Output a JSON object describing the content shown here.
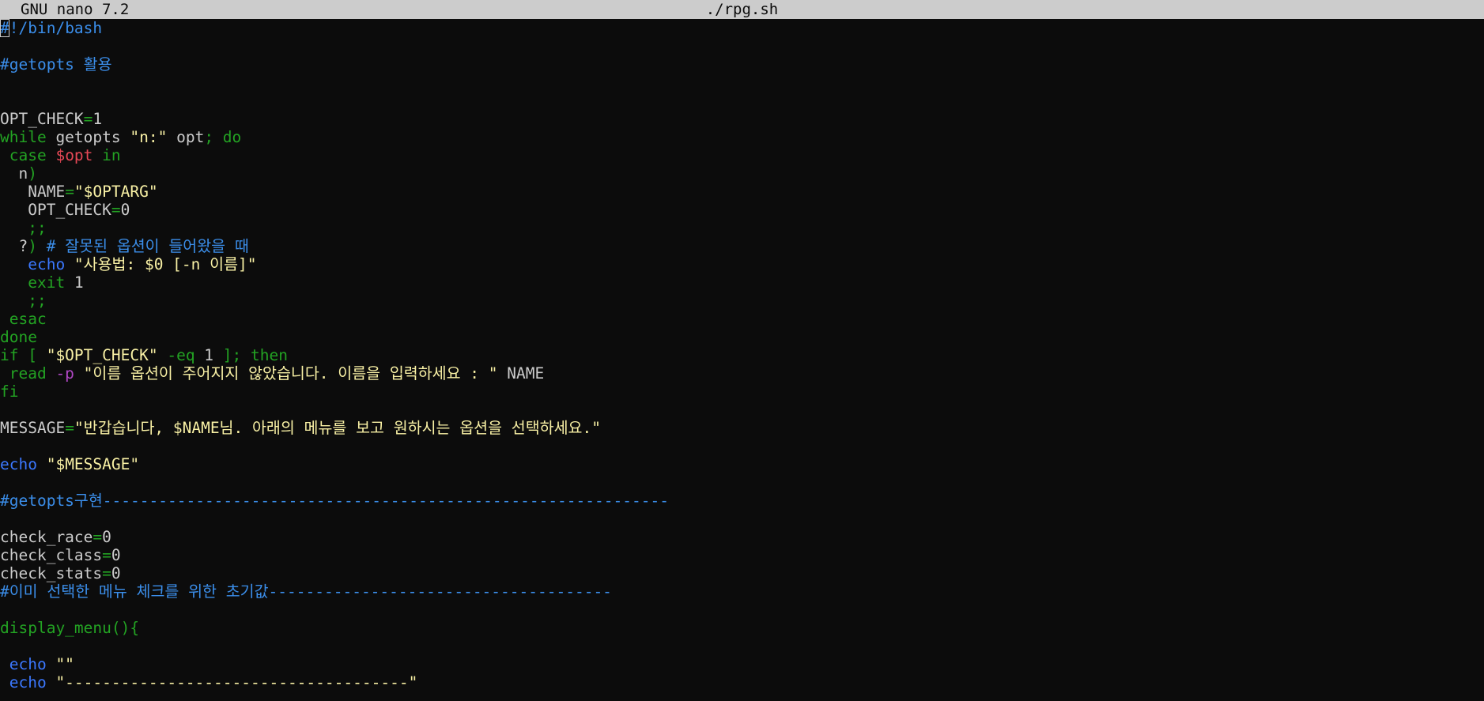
{
  "titlebar": {
    "app_name": "GNU nano 7.2",
    "file_name": "./rpg.sh"
  },
  "colors": {
    "background": "#0c0c0c",
    "default": "#cccccc",
    "comment": "#3b8eea",
    "keyword": "#23a323",
    "builtin": "#3b78ff",
    "string": "#f9f1a5",
    "variable": "#e74856",
    "option": "#b148c6",
    "titlebar": "#cccccc"
  },
  "lines": [
    [
      {
        "t": "#!/bin/bash",
        "c": "comment"
      }
    ],
    [],
    [
      {
        "t": "#getopts 활용",
        "c": "comment"
      }
    ],
    [],
    [],
    [
      {
        "t": "OPT_CHECK",
        "c": "default"
      },
      {
        "t": "=",
        "c": "keyword"
      },
      {
        "t": "1",
        "c": "default"
      }
    ],
    [
      {
        "t": "while",
        "c": "keyword"
      },
      {
        "t": " getopts ",
        "c": "default"
      },
      {
        "t": "\"n:\"",
        "c": "string"
      },
      {
        "t": " opt",
        "c": "default"
      },
      {
        "t": "; do",
        "c": "keyword"
      }
    ],
    [
      {
        "t": " case ",
        "c": "keyword"
      },
      {
        "t": "$opt",
        "c": "variable"
      },
      {
        "t": " in",
        "c": "keyword"
      }
    ],
    [
      {
        "t": "  n",
        "c": "default"
      },
      {
        "t": ")",
        "c": "keyword"
      }
    ],
    [
      {
        "t": "   NAME",
        "c": "default"
      },
      {
        "t": "=",
        "c": "keyword"
      },
      {
        "t": "\"$OPTARG\"",
        "c": "string"
      }
    ],
    [
      {
        "t": "   OPT_CHECK",
        "c": "default"
      },
      {
        "t": "=",
        "c": "keyword"
      },
      {
        "t": "0",
        "c": "default"
      }
    ],
    [
      {
        "t": "   ;;",
        "c": "keyword"
      }
    ],
    [
      {
        "t": "  ?",
        "c": "default"
      },
      {
        "t": ")",
        "c": "keyword"
      },
      {
        "t": " # 잘못된 옵션이 들어왔을 때",
        "c": "comment"
      }
    ],
    [
      {
        "t": "   echo",
        "c": "builtin"
      },
      {
        "t": " \"사용법: $0 [-n 이름]\"",
        "c": "string"
      }
    ],
    [
      {
        "t": "   exit",
        "c": "keyword"
      },
      {
        "t": " 1",
        "c": "default"
      }
    ],
    [
      {
        "t": "   ;;",
        "c": "keyword"
      }
    ],
    [
      {
        "t": " esac",
        "c": "keyword"
      }
    ],
    [
      {
        "t": "done",
        "c": "keyword"
      }
    ],
    [
      {
        "t": "if [ ",
        "c": "keyword"
      },
      {
        "t": "\"$OPT_CHECK\"",
        "c": "string"
      },
      {
        "t": " -eq",
        "c": "keyword"
      },
      {
        "t": " 1 ",
        "c": "default"
      },
      {
        "t": "]; then",
        "c": "keyword"
      }
    ],
    [
      {
        "t": " read",
        "c": "keyword"
      },
      {
        "t": " -p",
        "c": "option"
      },
      {
        "t": " \"이름 옵션이 주어지지 않았습니다. 이름을 입력하세요 : \"",
        "c": "string"
      },
      {
        "t": " NAME",
        "c": "default"
      }
    ],
    [
      {
        "t": "fi",
        "c": "keyword"
      }
    ],
    [],
    [
      {
        "t": "MESSAGE",
        "c": "default"
      },
      {
        "t": "=",
        "c": "keyword"
      },
      {
        "t": "\"반갑습니다, $NAME님. 아래의 메뉴를 보고 원하시는 옵션을 선택하세요.\"",
        "c": "string"
      }
    ],
    [],
    [
      {
        "t": "echo",
        "c": "builtin"
      },
      {
        "t": " \"$MESSAGE\"",
        "c": "string"
      }
    ],
    [],
    [
      {
        "t": "#getopts구현-------------------------------------------------------------",
        "c": "comment"
      }
    ],
    [],
    [
      {
        "t": "check_race",
        "c": "default"
      },
      {
        "t": "=",
        "c": "keyword"
      },
      {
        "t": "0",
        "c": "default"
      }
    ],
    [
      {
        "t": "check_class",
        "c": "default"
      },
      {
        "t": "=",
        "c": "keyword"
      },
      {
        "t": "0",
        "c": "default"
      }
    ],
    [
      {
        "t": "check_stats",
        "c": "default"
      },
      {
        "t": "=",
        "c": "keyword"
      },
      {
        "t": "0",
        "c": "default"
      }
    ],
    [
      {
        "t": "#이미 선택한 메뉴 체크를 위한 초기값-------------------------------------",
        "c": "comment"
      }
    ],
    [],
    [
      {
        "t": "display_menu(){",
        "c": "keyword"
      }
    ],
    [],
    [
      {
        "t": " echo",
        "c": "builtin"
      },
      {
        "t": " \"\"",
        "c": "string"
      }
    ],
    [
      {
        "t": " echo",
        "c": "builtin"
      },
      {
        "t": " \"-------------------------------------\"",
        "c": "string"
      }
    ]
  ]
}
